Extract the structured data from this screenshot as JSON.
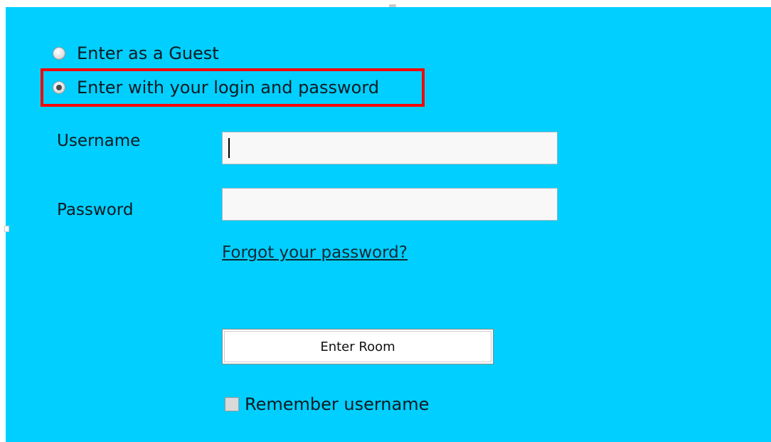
{
  "login_mode": {
    "options": [
      {
        "label": "Enter as a Guest",
        "selected": false
      },
      {
        "label": "Enter with your login and password",
        "selected": true
      }
    ],
    "highlight_color": "#ff0000"
  },
  "form": {
    "username_label": "Username",
    "username_value": "",
    "password_label": "Password",
    "password_value": "",
    "forgot_link": "Forgot your password?",
    "submit_label": "Enter Room",
    "remember_label": "Remember username",
    "remember_checked": false
  },
  "colors": {
    "background": "#00cfff",
    "highlight": "#ff0000"
  }
}
